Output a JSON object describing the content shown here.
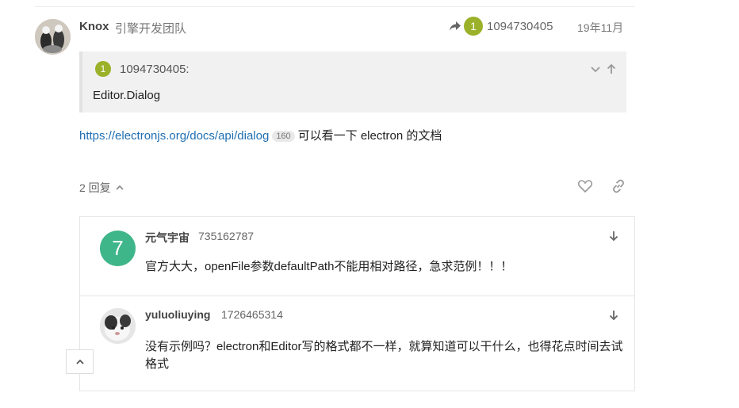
{
  "post": {
    "username": "Knox",
    "group": "引擎开发团队",
    "reply_to_count": "1",
    "reply_to_user": "1094730405",
    "date": "19年11月",
    "quote": {
      "badge": "1",
      "author": "1094730405:",
      "text": "Editor.Dialog"
    },
    "link_text": "https://electronjs.org/docs/api/dialog",
    "link_clicks": "160",
    "body_suffix": "可以看一下 electron 的文档",
    "replies_label": "2 回复"
  },
  "replies": [
    {
      "avatar_letter": "7",
      "username": "元气宇宙",
      "user_id": "735162787",
      "text": "官方大大，openFile参数defaultPath不能用相对路径，急求范例！！！"
    },
    {
      "username": "yuluoliuying",
      "user_id": "1726465314",
      "text_line1": "没有示例吗？electron和Editor写的格式都不一样，就算知道可以干什么，也得花点时间去试",
      "text_line2": "格式"
    }
  ],
  "colors": {
    "badge": "#9cb12a",
    "avatar_7": "#3fb689",
    "link": "#1f6fb2"
  },
  "icons": [
    "reply-arrow-icon",
    "chevron-down-icon",
    "arrow-up-icon",
    "chevron-up-icon",
    "heart-icon",
    "link-icon",
    "arrow-down-icon"
  ]
}
